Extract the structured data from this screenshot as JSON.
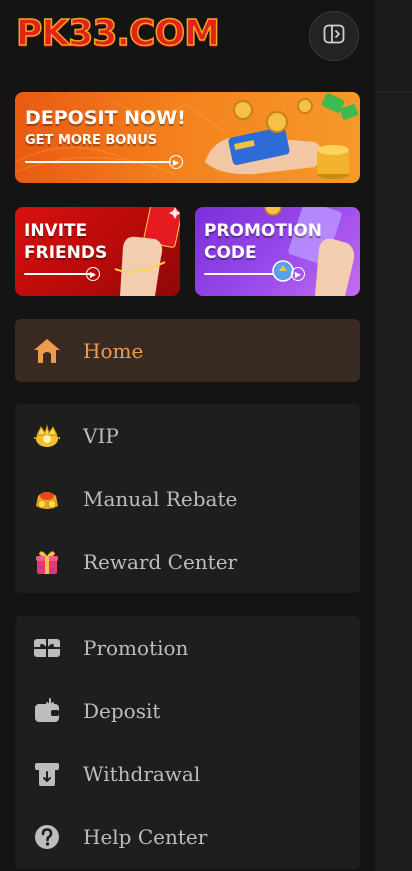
{
  "brand": {
    "logo_text": "PK33.COM",
    "logo_color": "#e2231a",
    "logo_outline": "#f6a21a"
  },
  "header": {
    "collapse_icon": "sidebar-toggle-icon"
  },
  "banners": {
    "deposit": {
      "line1": "DEPOSIT NOW!",
      "line2": "GET MORE BONUS"
    },
    "invite": {
      "line1": "INVITE",
      "line2": "FRIENDS"
    },
    "promo": {
      "line1": "PROMOTION",
      "line2": "CODE"
    }
  },
  "nav": {
    "home": {
      "label": "Home",
      "icon": "home-icon",
      "active": true,
      "accent": "#f09a50"
    },
    "group1": [
      {
        "label": "VIP",
        "icon": "vip-crown-icon"
      },
      {
        "label": "Manual Rebate",
        "icon": "rebate-coins-icon"
      },
      {
        "label": "Reward Center",
        "icon": "gift-box-icon"
      }
    ],
    "group2": [
      {
        "label": "Promotion",
        "icon": "promotion-ticket-icon"
      },
      {
        "label": "Deposit",
        "icon": "wallet-icon"
      },
      {
        "label": "Withdrawal",
        "icon": "withdrawal-icon"
      },
      {
        "label": "Help Center",
        "icon": "help-question-icon"
      }
    ]
  }
}
